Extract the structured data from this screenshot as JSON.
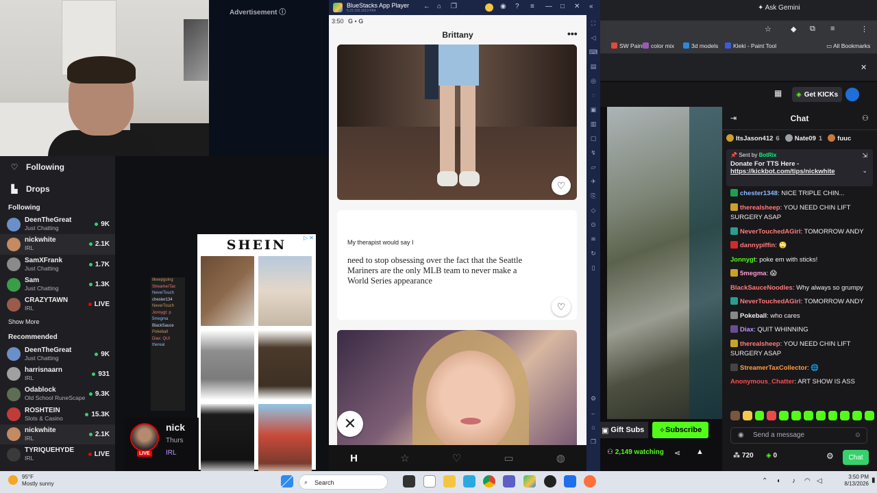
{
  "webcam": {},
  "ad": {
    "label": "Advertisement ⓘ",
    "brand": "SHEIN",
    "close": "▷ ✕"
  },
  "sidebar": {
    "following_label": "Following",
    "drops_label": "Drops",
    "following_title": "Following",
    "following": [
      {
        "name": "DeenTheGreat",
        "category": "Just Chatting",
        "viewers": "9K",
        "color": "#6b8fc9"
      },
      {
        "name": "nickwhite",
        "category": "IRL",
        "viewers": "2.1K",
        "color": "#c48a62"
      },
      {
        "name": "SamXFrank",
        "category": "Just Chatting",
        "viewers": "1.7K",
        "color": "#8a8a8a"
      },
      {
        "name": "Sam",
        "category": "Just Chatting",
        "viewers": "1.3K",
        "color": "#3a9e48"
      },
      {
        "name": "CRAZYTAWN",
        "category": "IRL",
        "viewers": "LIVE",
        "color": "#9a5b4c"
      }
    ],
    "show_more": "Show More",
    "recommended_title": "Recommended",
    "recommended": [
      {
        "name": "DeenTheGreat",
        "category": "Just Chatting",
        "viewers": "9K",
        "color": "#6b8fc9"
      },
      {
        "name": "harrisnaarn",
        "category": "IRL",
        "viewers": "931",
        "color": "#a0a0a0"
      },
      {
        "name": "Odablock",
        "category": "Old School RuneScape",
        "viewers": "9.3K",
        "color": "#5e6e54"
      },
      {
        "name": "ROSHTEIN",
        "category": "Slots & Casino",
        "viewers": "15.3K",
        "color": "#c23b3b"
      },
      {
        "name": "nickwhite",
        "category": "IRL",
        "viewers": "2.1K",
        "color": "#c48a62"
      },
      {
        "name": "TYRIQUEHYDE",
        "category": "IRL",
        "viewers": "LIVE",
        "color": "#3a3a3a"
      }
    ]
  },
  "overlay_chat": [
    "itkeepgoing",
    "StreamerTax",
    "NeverTouch",
    "chester134",
    "NeverTouch",
    "Jonnygt: p",
    "5megma",
    "BlackSauce",
    "Pokeball",
    "Diax: QUI",
    "thereal"
  ],
  "streamer": {
    "name": "nick",
    "title": "Thurs",
    "category": "IRL",
    "live": "LIVE"
  },
  "bluestacks": {
    "title": "BlueStacks App Player",
    "version": "5.22.150.1013 P64",
    "time": "3:50",
    "profile_name": "Brittany",
    "prompt_question": "My therapist would say I",
    "prompt_answer": "need to stop obsessing over the fact that the Seattle Mariners are the only MLB team to never make a World Series appearance"
  },
  "browser": {
    "ask_gemini": "Ask Gemini",
    "bookmarks": [
      {
        "label": "SW Paint",
        "color": "#e04a3f"
      },
      {
        "label": "color mix",
        "color": "#9b59b6"
      },
      {
        "label": "3d models",
        "color": "#2e86de"
      },
      {
        "label": "Kleki - Paint Tool",
        "color": "#3b5bdb"
      }
    ],
    "all_bookmarks": "All Bookmarks"
  },
  "kick": {
    "get_kicks": "Get KICKs"
  },
  "chat": {
    "header": "Chat",
    "leaderboard": [
      {
        "user": "ItsJason412",
        "count": "6"
      },
      {
        "user": "Nate09",
        "count": "1"
      },
      {
        "user": "fuuc",
        "count": ""
      }
    ],
    "pinned_sender": "BotRix",
    "pinned_prefix": "Sent by",
    "pinned_text": "Donate For TTS Here -",
    "pinned_link": "https://kickbot.com/tips/nickwhite",
    "messages": [
      {
        "user": "chester1348",
        "text": ": NICE TRIPLE CHIN...",
        "color": "#8bb8ff",
        "badge": "#1f9d55"
      },
      {
        "user": "therealsheep",
        "text": ": YOU NEED CHIN LIFT SURGERY ASAP",
        "color": "#ff7a7a",
        "badge": "#c9a227"
      },
      {
        "user": "NeverTouchedAGirl",
        "text": ": TOMORROW ANDY",
        "color": "#ff7a7a",
        "badge": "#2a9d8f"
      },
      {
        "user": "dannypiffin",
        "text": ": 🙄",
        "color": "#ff7a7a",
        "badge": "#d62828"
      },
      {
        "user": "Jonnygt",
        "text": ": poke em with sticks!",
        "color": "#53fc18",
        "badge": ""
      },
      {
        "user": "5megma",
        "text": ": 😱",
        "color": "#ff9bd2",
        "badge": "#c9a227"
      },
      {
        "user": "BlackSauceNoodles",
        "text": ": Why always so grumpy",
        "color": "#ff7a7a",
        "badge": ""
      },
      {
        "user": "NeverTouchedAGirl",
        "text": ": TOMORROW ANDY",
        "color": "#ff7a7a",
        "badge": "#2a9d8f"
      },
      {
        "user": "Pokeball",
        "text": ": who cares",
        "color": "#efeff1",
        "badge": "#888"
      },
      {
        "user": "Diax",
        "text": ": QUIT WHINNING",
        "color": "#bf94ff",
        "badge": "#6a4c93"
      },
      {
        "user": "therealsheep",
        "text": ": YOU NEED CHIN LIFT SURGERY ASAP",
        "color": "#ff7a7a",
        "badge": "#c9a227"
      },
      {
        "user": "StreamerTaxCollector",
        "text": ": 🌐",
        "color": "#ff9f43",
        "badge": "#444"
      },
      {
        "user": "Anonymous_Chatter",
        "text": ": ART SHOW IS ASS",
        "color": "#ff4d4d",
        "badge": ""
      }
    ],
    "input_placeholder": "Send a message",
    "points": "720",
    "kicks": "0",
    "chat_button": "Chat"
  },
  "stream": {
    "gift_subs": "Gift Subs",
    "subscribe": "Subscribe",
    "watching": "2,149 watching"
  },
  "taskbar": {
    "temp": "95°F",
    "weather": "Mostly sunny",
    "search": "Search",
    "time": "3:50 PM",
    "date": "8/13/2026"
  }
}
